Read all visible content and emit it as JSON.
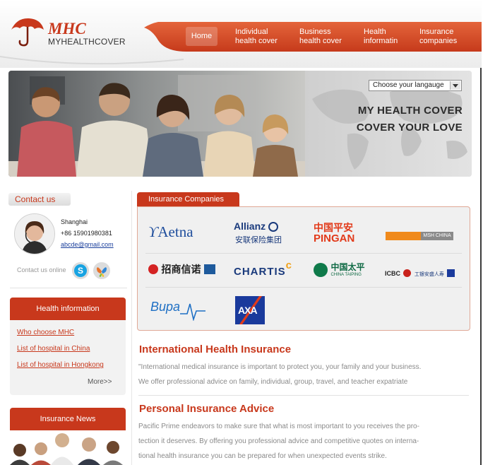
{
  "header": {
    "brand": "MHC",
    "brand_sub": "MYHEALTHCOVER",
    "nav": [
      {
        "line1": "Home",
        "line2": ""
      },
      {
        "line1": "Individual",
        "line2": "health cover"
      },
      {
        "line1": "Business",
        "line2": "health cover"
      },
      {
        "line1": "Health",
        "line2": "informatin"
      },
      {
        "line1": "Insurance",
        "line2": "companies"
      }
    ]
  },
  "banner": {
    "language_select": "Choose your langauge",
    "slogan_line1": "MY HEALTH COVER",
    "slogan_line2": "COVER YOUR LOVE"
  },
  "contact": {
    "tab_label": "Contact us",
    "city": "Shanghai",
    "phone": "+86 15901980381",
    "email": "abcde@gmail.com",
    "online_label": "Contact us online"
  },
  "health_info": {
    "title": "Health information",
    "links": [
      "Who choose MHC",
      "List of hospital in China",
      "List of hospital in Hongkong"
    ],
    "more": "More>>"
  },
  "news": {
    "title": "Insurance News"
  },
  "companies": {
    "tab_label": "Insurance Companies",
    "logos": {
      "aetna": "Aetna",
      "allianz_en": "Allianz",
      "allianz_cn": "安联保险集团",
      "pingan_cn": "中国平安",
      "pingan_en": "PINGAN",
      "msh": "MSH CHINA",
      "cmb_cn": "招商信诺",
      "chartis": "CHARTIS",
      "taiping_cn": "中国太平",
      "taiping_en": "CHINA TAIPING",
      "icbc": "ICBC",
      "icbc_axa_cn": "工银安盛人寿",
      "bupa": "Bupa",
      "axa": "AXA"
    }
  },
  "sections": [
    {
      "title": "International Health Insurance",
      "lines": [
        "\"International medical insurance is important to protect you, your family and your business.",
        "We offer professional advice on family, individual, group, travel, and teacher expatriate"
      ]
    },
    {
      "title": "Personal Insurance Advice",
      "lines": [
        "Pacific Prime endeavors to make sure that what is most important to you receives the pro-",
        "tection it deserves. By offering you professional advice and competitive quotes on interna-",
        "tional health insurance you can be prepared for when unexpected events strike."
      ]
    }
  ],
  "colors": {
    "brand_red": "#c8381c",
    "nav_orange": "#d9542d",
    "panel_grey": "#f2f2f2"
  }
}
